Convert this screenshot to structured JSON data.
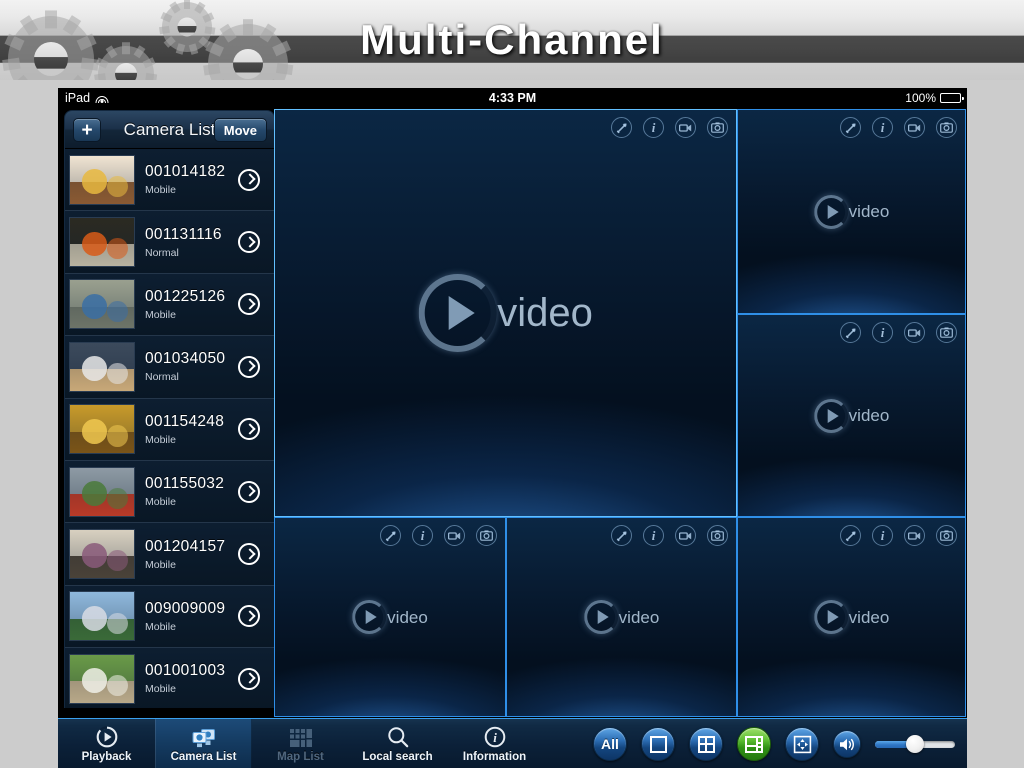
{
  "banner": {
    "title": "Multi-Channel"
  },
  "statusbar": {
    "device": "iPad",
    "wifi_icon": "wifi-icon",
    "time": "4:33 PM",
    "battery_text": "100%",
    "battery_level": 100
  },
  "sidebar": {
    "add_label": "+",
    "title": "Camera List",
    "move_label": "Move",
    "cameras": [
      {
        "id": "001014182",
        "status": "Mobile",
        "thumb": {
          "sky": "#f0e4d2",
          "ground": "#8a5a33",
          "accent": "#e8b93f"
        }
      },
      {
        "id": "001131116",
        "status": "Normal",
        "thumb": {
          "sky": "#2b2a22",
          "ground": "#b8b2a0",
          "accent": "#d85a18"
        }
      },
      {
        "id": "001225126",
        "status": "Mobile",
        "thumb": {
          "sky": "#9aa08f",
          "ground": "#6d7468",
          "accent": "#3a6ea5"
        }
      },
      {
        "id": "001034050",
        "status": "Normal",
        "thumb": {
          "sky": "#3c4a5c",
          "ground": "#c8a878",
          "accent": "#e8e8e8"
        }
      },
      {
        "id": "001154248",
        "status": "Mobile",
        "thumb": {
          "sky": "#c89a2a",
          "ground": "#7a5418",
          "accent": "#f0c850"
        }
      },
      {
        "id": "001155032",
        "status": "Mobile",
        "thumb": {
          "sky": "#8e9aa4",
          "ground": "#b83a28",
          "accent": "#4a7a3a"
        }
      },
      {
        "id": "001204157",
        "status": "Mobile",
        "thumb": {
          "sky": "#d8d0c0",
          "ground": "#4a4238",
          "accent": "#8a5a7a"
        }
      },
      {
        "id": "009009009",
        "status": "Mobile",
        "thumb": {
          "sky": "#8fb8dc",
          "ground": "#3a6a38",
          "accent": "#d8dce4"
        }
      },
      {
        "id": "001001003",
        "status": "Mobile",
        "thumb": {
          "sky": "#6a9a48",
          "ground": "#b8a888",
          "accent": "#f0f0e8"
        }
      }
    ],
    "chevron_icon": "chevron-right-icon"
  },
  "grid": {
    "layout": "6-split",
    "placeholder_label": "video",
    "pane_tools": [
      {
        "name": "ptz-icon",
        "title": "PTZ"
      },
      {
        "name": "info-icon",
        "title": "Information"
      },
      {
        "name": "record-icon",
        "title": "Record"
      },
      {
        "name": "snapshot-icon",
        "title": "Snapshot"
      }
    ],
    "panes": [
      {
        "index": 1,
        "size": "large"
      },
      {
        "index": 2,
        "size": "small"
      },
      {
        "index": 3,
        "size": "small"
      },
      {
        "index": 4,
        "size": "small"
      },
      {
        "index": 5,
        "size": "small"
      },
      {
        "index": 6,
        "size": "small"
      }
    ]
  },
  "toolbar": {
    "tabs": [
      {
        "label": "Playback",
        "icon": "playback-icon",
        "state": "normal"
      },
      {
        "label": "Camera List",
        "icon": "camera-list-icon",
        "state": "active"
      },
      {
        "label": "Map List",
        "icon": "map-list-icon",
        "state": "disabled"
      },
      {
        "label": "Local search",
        "icon": "search-icon",
        "state": "normal"
      },
      {
        "label": "Information",
        "icon": "info-icon",
        "state": "normal"
      }
    ],
    "controls": [
      {
        "name": "all-channels-button",
        "label": "All",
        "icon": "text",
        "active": false
      },
      {
        "name": "layout-1-button",
        "label": "",
        "icon": "square",
        "active": false
      },
      {
        "name": "layout-4-button",
        "label": "",
        "icon": "grid4",
        "active": false
      },
      {
        "name": "layout-6-button",
        "label": "",
        "icon": "grid6",
        "active": true
      },
      {
        "name": "fullscreen-button",
        "label": "",
        "icon": "expand",
        "active": false
      }
    ],
    "volume": {
      "icon": "speaker-icon",
      "value": 50
    }
  },
  "colors": {
    "accent_blue": "#2f8fe8",
    "active_green": "#5cbd32",
    "banner_dark": "#454545",
    "page_bg": "#cccccc"
  }
}
